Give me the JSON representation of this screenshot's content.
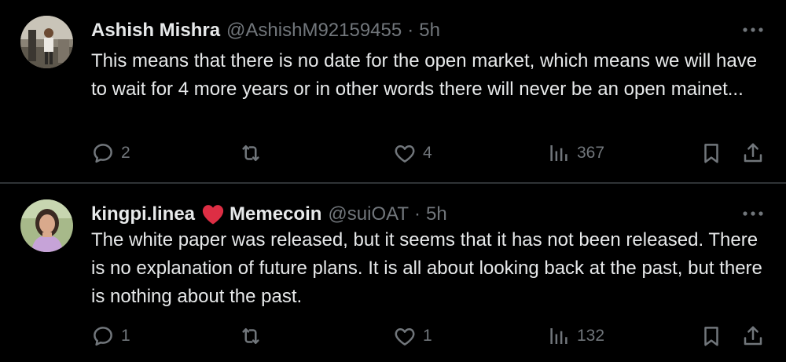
{
  "colors": {
    "background": "#000000",
    "text_primary": "#e7e9ea",
    "text_secondary": "#71767b",
    "divider": "#2f3336",
    "heart": "#f91880"
  },
  "tweets": [
    {
      "author_name": "Ashish Mishra",
      "author_handle": "@AshishM92159455",
      "separator": "·",
      "time": "5h",
      "text": "This means that there is no date for the open market, which means we will have to wait for 4 more years or in other words there will never be an open mainet...",
      "replies": "2",
      "reposts": "",
      "likes": "4",
      "views": "367"
    },
    {
      "author_name": "kingpi.linea",
      "author_name_suffix": "Memecoin",
      "author_handle": "@suiOAT",
      "separator": "·",
      "time": "5h",
      "text": "The white paper was released, but it seems that it has not been released. There is no explanation of future plans. It is all about looking back at the past, but there is nothing about the past.",
      "replies": "1",
      "reposts": "",
      "likes": "1",
      "views": "132"
    }
  ],
  "icons": {
    "reply": "reply-icon",
    "repost": "repost-icon",
    "like": "heart-outline-icon",
    "views": "analytics-icon",
    "bookmark": "bookmark-icon",
    "share": "share-icon",
    "more": "more-options-icon",
    "name_emoji": "red-heart-icon"
  }
}
